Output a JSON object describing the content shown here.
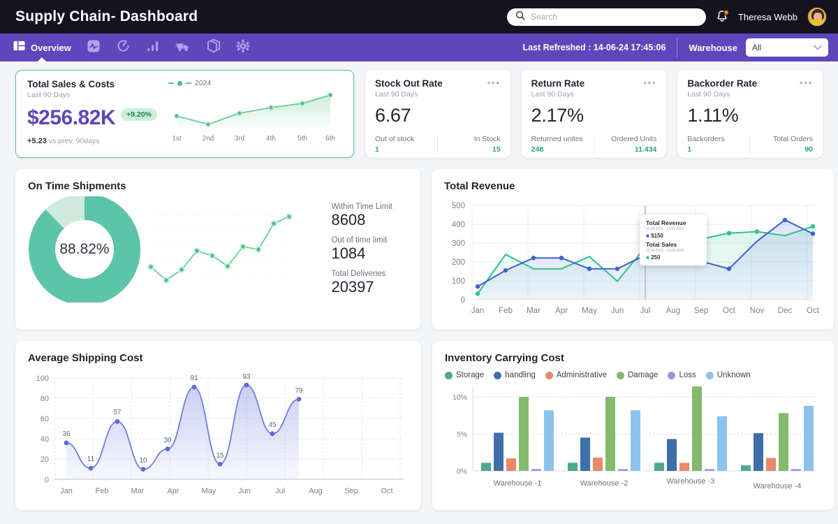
{
  "header": {
    "title": "Supply Chain- Dashboard",
    "search": {
      "placeholder": "Search",
      "value": ""
    },
    "user_name": "Theresa Webb",
    "notification_icon": "bell-icon",
    "search_icon": "search-icon"
  },
  "nav": {
    "items": [
      {
        "label": "Overview",
        "icon": "dashboard-layout-icon",
        "active": true
      },
      {
        "label": "",
        "icon": "activity-pulse-icon",
        "active": false
      },
      {
        "label": "",
        "icon": "refresh-gauge-icon",
        "active": false
      },
      {
        "label": "",
        "icon": "bar-chart-icon",
        "active": false
      },
      {
        "label": "",
        "icon": "truck-icon",
        "active": false
      },
      {
        "label": "",
        "icon": "package-box-icon",
        "active": false
      },
      {
        "label": "",
        "icon": "gear-icon",
        "active": false
      }
    ],
    "last_refreshed": "Last Refreshed : 14-06-24  17:45:06",
    "warehouse_label": "Warehouse",
    "warehouse_value": "All",
    "chevron_icon": "chevron-down-icon"
  },
  "kpi_main": {
    "title": "Total Sales & Costs",
    "subtitle": "Last 90 Days",
    "value": "$256.82K",
    "badge": "+9.20%",
    "delta": "+5.23",
    "delta_note": "vs prev. 90days",
    "legend": "2024"
  },
  "kpi_cards": [
    {
      "title": "Stock Out Rate",
      "subtitle": "Last 90 Days",
      "value": "6.67",
      "left_label": "Out of stock",
      "left_value": "1",
      "right_label": "In Stock",
      "right_value": "15",
      "menu_icon": "more-options-icon"
    },
    {
      "title": "Return Rate",
      "subtitle": "Last 90 Days",
      "value": "2.17%",
      "left_label": "Returned unites",
      "left_value": "248",
      "right_label": "Ordered Units",
      "right_value": "11.434",
      "menu_icon": "more-options-icon"
    },
    {
      "title": "Backorder Rate",
      "subtitle": "Last 90 Days",
      "value": "1.11%",
      "left_label": "Backorders",
      "left_value": "1",
      "right_label": "Total Orders",
      "right_value": "90",
      "menu_icon": "more-options-icon"
    }
  ],
  "on_time": {
    "title": "On Time Shipments",
    "donut_label": "88.82%",
    "stats": [
      {
        "label": "Within Time Limit",
        "value": "8608"
      },
      {
        "label": "Out of time limit",
        "value": "1084"
      },
      {
        "label": "Total Deliveries",
        "value": "20397"
      }
    ]
  },
  "total_revenue": {
    "title": "Total Revenue"
  },
  "avg_shipping": {
    "title": "Average Shipping Cost"
  },
  "inventory": {
    "title": "Inventory Carrying Cost"
  },
  "tooltip": {
    "series1_name": "Total Revenue",
    "series1_range": "12.04.2022 - 13.05.2022",
    "series1_value": "$150",
    "series2_name": "Total Sales",
    "series2_range": "12.04.2022 - 13.05.2022",
    "series2_value": "250"
  },
  "colors": {
    "brand_purple": "#5e46bd",
    "dark_header": "#15131f",
    "green": "#4cbd7c",
    "teal": "#5cc5a7",
    "teal_light": "#cfeadf",
    "blue": "#3f5fd6",
    "blue_soft": "#7d8fe8",
    "spring_green": "#2ec28a"
  },
  "chart_data": [
    {
      "type": "line",
      "name": "total-sales-costs-sparkline",
      "title": "Total Sales & Costs",
      "categories": [
        "1st",
        "2nd",
        "3rd",
        "4th",
        "5th",
        "6th"
      ],
      "values": [
        36,
        22,
        42,
        54,
        64,
        88
      ],
      "series": [
        {
          "name": "2024",
          "values": [
            36,
            22,
            42,
            54,
            64,
            88
          ]
        }
      ],
      "ylim": [
        0,
        100
      ],
      "xlabel": "",
      "ylabel": "",
      "grid": false,
      "legend_position": "top-left"
    },
    {
      "type": "pie",
      "name": "on-time-shipments-donut",
      "title": "On Time Shipments",
      "labels": [
        "Within Time Limit",
        "Out of time limit"
      ],
      "values": [
        88.82,
        11.18
      ],
      "center_label": "88.82%",
      "colors": [
        "#5cc5a7",
        "#cfeadf"
      ]
    },
    {
      "type": "line",
      "name": "on-time-shipments-sparkline",
      "title": "",
      "x": [
        1,
        2,
        3,
        4,
        5,
        6,
        7,
        8,
        9,
        10
      ],
      "values": [
        26,
        14,
        24,
        46,
        41,
        30,
        52,
        50,
        74,
        81
      ],
      "ylim": [
        0,
        100
      ],
      "grid": true
    },
    {
      "type": "area",
      "name": "total-revenue-chart",
      "title": "Total Revenue",
      "categories": [
        "Jan",
        "Feb",
        "Mar",
        "Apr",
        "May",
        "Jun",
        "Jul",
        "Aug",
        "Sep",
        "Oct",
        "Nov",
        "Dec",
        "Oct"
      ],
      "series": [
        {
          "name": "Total Revenue",
          "color": "#3f5fd6",
          "values": [
            70,
            152,
            218,
            218,
            164,
            164,
            236,
            205,
            204,
            164,
            310,
            423,
            350
          ]
        },
        {
          "name": "Total Sales",
          "color": "#2ec28a",
          "values": [
            32,
            240,
            164,
            164,
            229,
            98,
            278,
            307,
            322,
            353,
            361,
            340,
            388
          ]
        }
      ],
      "ylim": [
        0,
        500
      ],
      "yticks": [
        0,
        100,
        200,
        300,
        400,
        500
      ],
      "xlabel": "",
      "ylabel": "",
      "grid": true,
      "legend_position": "none"
    },
    {
      "type": "area",
      "name": "average-shipping-cost-chart",
      "title": "Average Shipping Cost",
      "categories": [
        "Jan",
        "Feb",
        "Mar",
        "Apr",
        "May",
        "Jun",
        "Jul",
        "Aug",
        "Sep",
        "Oct"
      ],
      "values": [
        36,
        11,
        57,
        10,
        30,
        91,
        15,
        93,
        45,
        79
      ],
      "data_labels": [
        36,
        11,
        57,
        10,
        30,
        91,
        15,
        93,
        45,
        79
      ],
      "ylim": [
        0,
        100
      ],
      "yticks": [
        0,
        20,
        40,
        60,
        80,
        100
      ],
      "xlabel": "",
      "ylabel": "",
      "grid": true,
      "legend_position": "none"
    },
    {
      "type": "bar",
      "name": "inventory-carrying-cost-chart",
      "title": "Inventory Carrying Cost",
      "categories": [
        "Warehouse -1",
        "Warehouse -2",
        "Warehouse -3",
        "Warehouse -4"
      ],
      "series": [
        {
          "name": "Storage",
          "color": "#4fa795",
          "values": [
            1.1,
            1.1,
            1.1,
            0.75
          ]
        },
        {
          "name": "handling",
          "color": "#3f6fa8",
          "values": [
            5.15,
            4.5,
            4.3,
            5.1
          ]
        },
        {
          "name": "Administrative",
          "color": "#e8896a",
          "values": [
            1.7,
            1.8,
            1.1,
            1.75
          ]
        },
        {
          "name": "Damage",
          "color": "#83ba6e",
          "values": [
            10.0,
            10.0,
            11.4,
            7.8
          ]
        },
        {
          "name": "Loss",
          "color": "#9b94e0",
          "values": [
            0.25,
            0.25,
            0.25,
            0.25
          ]
        },
        {
          "name": "Unknown",
          "color": "#8dc3ea",
          "values": [
            8.2,
            8.2,
            7.4,
            8.8
          ]
        }
      ],
      "ylim": [
        0,
        12
      ],
      "yticks": [
        "0%",
        "5%",
        "10%"
      ],
      "xlabel": "",
      "ylabel": "",
      "grid": true,
      "legend_position": "top"
    }
  ]
}
